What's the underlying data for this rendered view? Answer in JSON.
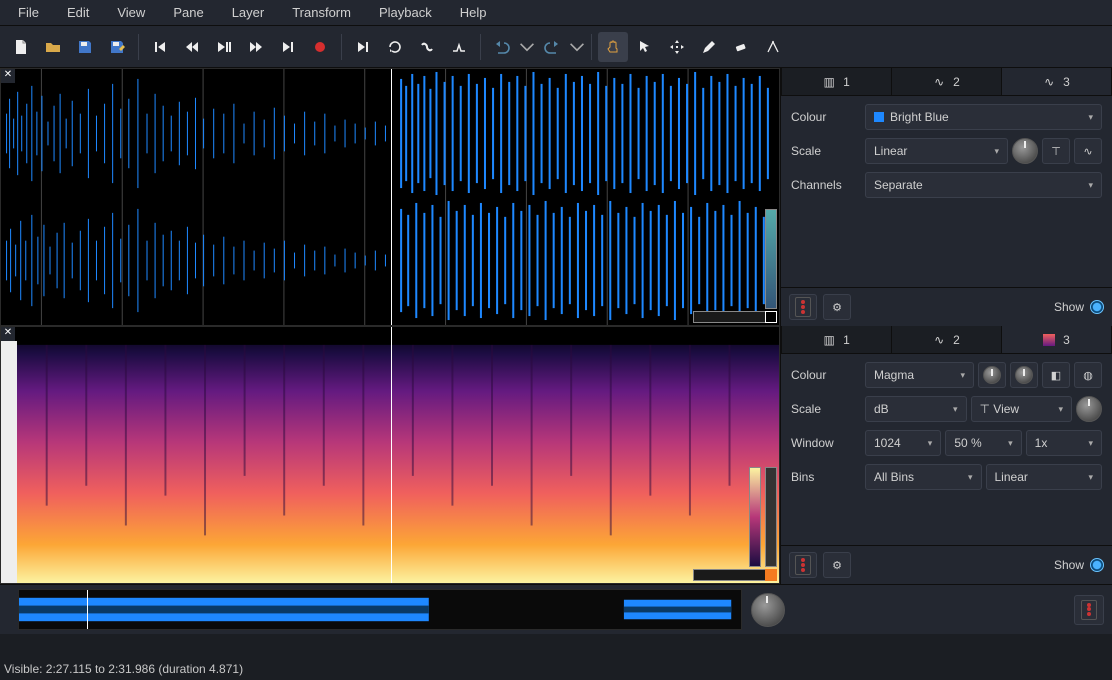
{
  "menu": {
    "items": [
      "File",
      "Edit",
      "View",
      "Pane",
      "Layer",
      "Transform",
      "Playback",
      "Help"
    ]
  },
  "toolbar": {
    "icons": [
      "new-file",
      "open-file",
      "save-file",
      "save-as",
      "skip-start",
      "rewind",
      "play-pause",
      "fast-forward",
      "skip-end",
      "record",
      "play-selection",
      "loop",
      "solo",
      "align",
      "undo",
      "undo-drop",
      "redo",
      "redo-drop",
      "hand",
      "pointer",
      "move",
      "pencil",
      "eraser",
      "measure"
    ]
  },
  "panel_waveform": {
    "tabs": [
      {
        "n": "1"
      },
      {
        "n": "2"
      },
      {
        "n": "3"
      }
    ],
    "active_tab": 2,
    "props": {
      "colour_label": "Colour",
      "colour_value": "Bright Blue",
      "scale_label": "Scale",
      "scale_value": "Linear",
      "channels_label": "Channels",
      "channels_value": "Separate"
    },
    "show_label": "Show"
  },
  "panel_spectrogram": {
    "tabs": [
      {
        "n": "1"
      },
      {
        "n": "2"
      },
      {
        "n": "3"
      }
    ],
    "active_tab": 2,
    "props": {
      "colour_label": "Colour",
      "colour_value": "Magma",
      "scale_label": "Scale",
      "scale_value": "dB",
      "view_label": "View",
      "window_label": "Window",
      "window_size": "1024",
      "window_overlap": "50 %",
      "window_oversample": "1x",
      "bins_label": "Bins",
      "bins_mode": "All Bins",
      "bins_scale": "Linear"
    },
    "show_label": "Show"
  },
  "status": {
    "text": "Visible: 2:27.115 to 2:31.986 (duration 4.871)"
  }
}
